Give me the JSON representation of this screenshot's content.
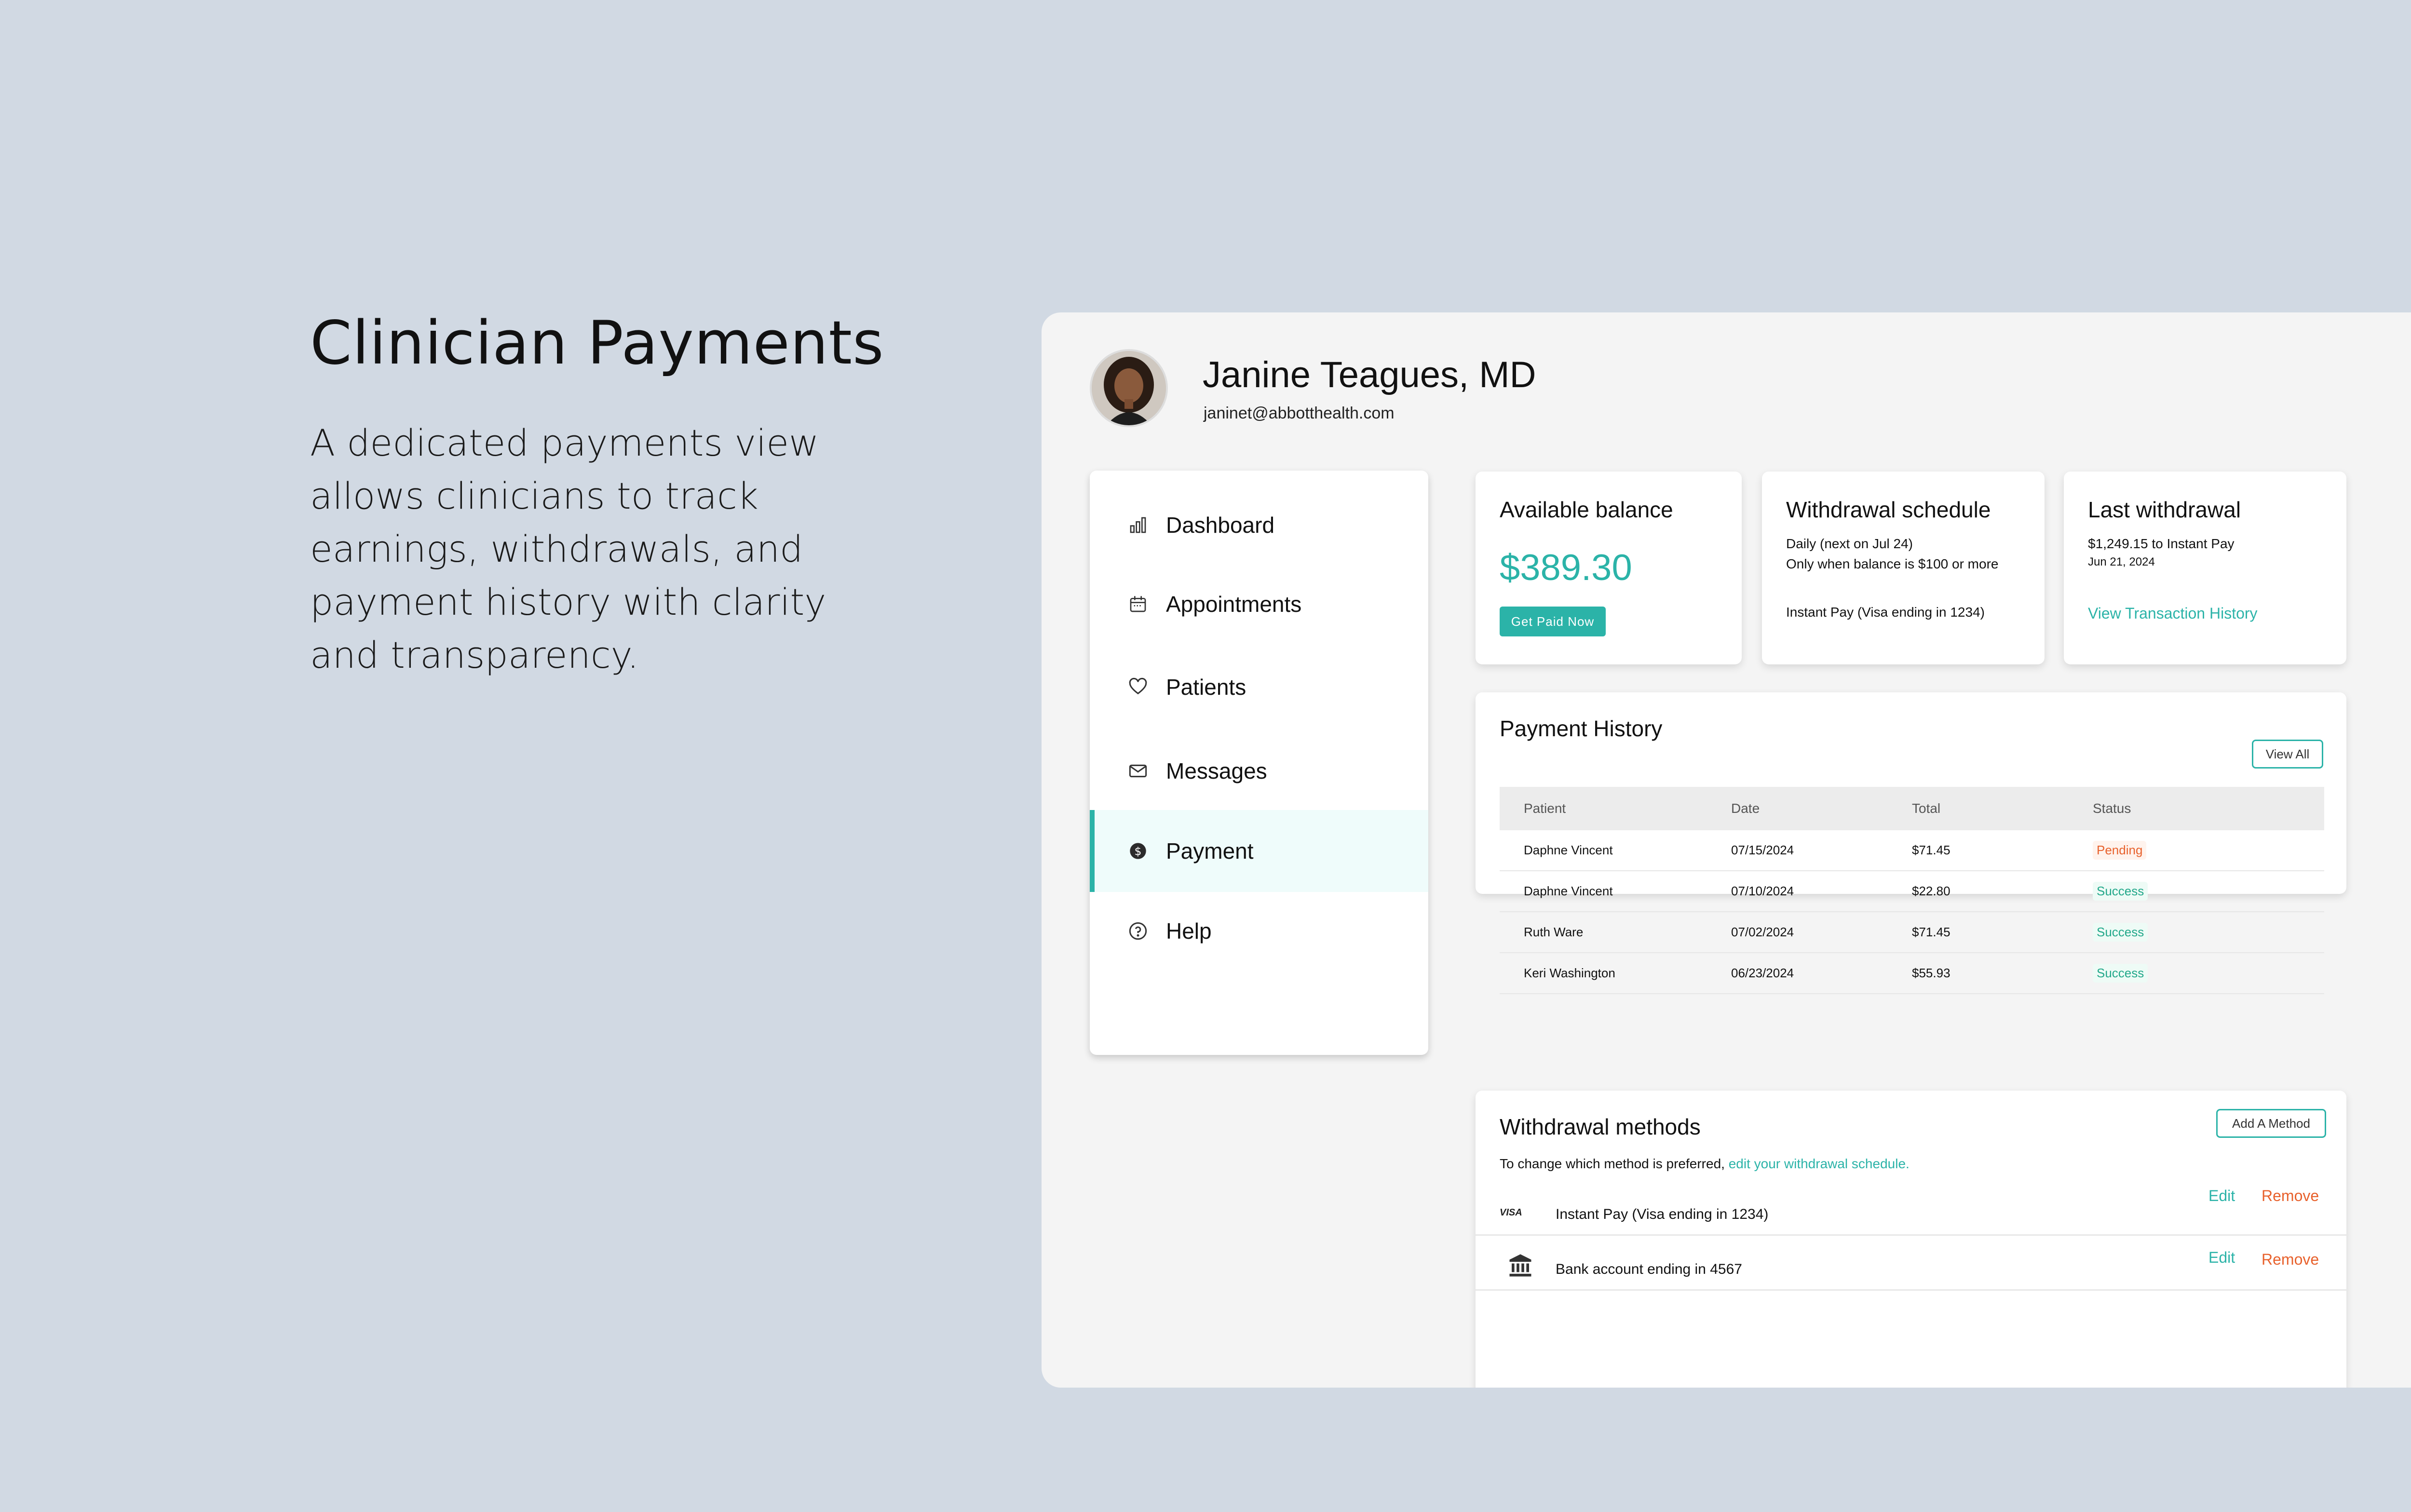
{
  "intro": {
    "title": "Clinician Payments",
    "description": "A dedicated payments view allows clinicians to track earnings, withdrawals, and payment history with clarity and transparency."
  },
  "profile": {
    "name": "Janine Teagues, MD",
    "email": "janinet@abbotthealth.com"
  },
  "sidebar": {
    "items": [
      {
        "label": "Dashboard",
        "icon": "bar-chart-icon"
      },
      {
        "label": "Appointments",
        "icon": "calendar-icon"
      },
      {
        "label": "Patients",
        "icon": "heart-icon"
      },
      {
        "label": "Messages",
        "icon": "envelope-icon"
      },
      {
        "label": "Payment",
        "icon": "dollar-circle-icon",
        "active": true
      },
      {
        "label": "Help",
        "icon": "question-circle-icon"
      }
    ]
  },
  "balance_card": {
    "title": "Available balance",
    "amount": "$389.30",
    "button": "Get Paid Now"
  },
  "schedule_card": {
    "title": "Withdrawal schedule",
    "line1": "Daily (next on Jul 24)",
    "line2": "Only when balance is $100 or more",
    "method": "Instant Pay (Visa ending in 1234)"
  },
  "last_withdrawal_card": {
    "title": "Last withdrawal",
    "line1": "$1,249.15 to Instant Pay",
    "date": "Jun 21, 2024",
    "link": "View Transaction History"
  },
  "payment_history": {
    "title": "Payment History",
    "view_all": "View All",
    "columns": [
      "Patient",
      "Date",
      "Total",
      "Status"
    ],
    "rows": [
      {
        "patient": "Daphne Vincent",
        "date": "07/15/2024",
        "total": "$71.45",
        "status": "Pending"
      },
      {
        "patient": "Daphne Vincent",
        "date": "07/10/2024",
        "total": "$22.80",
        "status": "Success"
      },
      {
        "patient": "Ruth Ware",
        "date": "07/02/2024",
        "total": "$71.45",
        "status": "Success"
      },
      {
        "patient": "Keri Washington",
        "date": "06/23/2024",
        "total": "$55.93",
        "status": "Success"
      }
    ]
  },
  "withdrawal_methods": {
    "title": "Withdrawal methods",
    "add_button": "Add A Method",
    "note_prefix": "To change which method is preferred, ",
    "note_link": "edit your withdrawal schedule.",
    "methods": [
      {
        "icon_text": "VISA",
        "label": "Instant Pay (Visa ending in 1234)",
        "edit": "Edit",
        "remove": "Remove"
      },
      {
        "icon": "bank-icon",
        "label": "Bank account ending in 4567",
        "edit": "Edit",
        "remove": "Remove"
      }
    ]
  },
  "colors": {
    "accent": "#2bb3a8",
    "danger": "#e8612c",
    "background": "#d1d9e3"
  }
}
